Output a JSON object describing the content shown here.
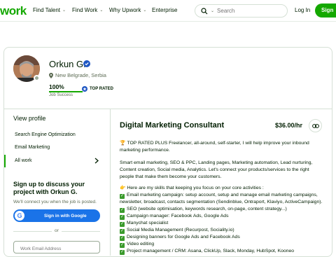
{
  "header": {
    "logo": "work",
    "nav": [
      {
        "label": "Find Talent"
      },
      {
        "label": "Find Work"
      },
      {
        "label": "Why Upwork"
      },
      {
        "label": "Enterprise"
      }
    ],
    "search_placeholder": "Search",
    "login": "Log In",
    "signup": "Sign"
  },
  "profile": {
    "name": "Orkun G.",
    "location": "New Belgrade, Serbia",
    "job_success_pct": "100%",
    "job_success_value": 100,
    "job_success_label": "Job Success",
    "badge": "TOP RATED"
  },
  "sidebar": {
    "view_profile": "View profile",
    "items": [
      {
        "label": "Search Engine Optimization"
      },
      {
        "label": "Email Marketing"
      },
      {
        "label": "All work"
      }
    ],
    "cta_title": "Sign up to discuss your project with Orkun G.",
    "cta_sub": "We'll connect you when the job is posted.",
    "google_btn": "Sign in with Google",
    "or": "or",
    "email_placeholder": "Work Email Address"
  },
  "main": {
    "title": "Digital Marketing Consultant",
    "rate": "$36.00/hr",
    "intro": "TOP RATED PLUS Freelancer, all-around, self-starter, I will help improve your inbound marketing performance.",
    "paragraph": "Smart email marketing, SEO & PPC, Landing pages, Marketing automation, Lead nurturing, Content creation, Social media, Analytics. Let's connect your products/services to the right people that make them become your customers.",
    "skills_intro": "Here are my skills that keeping you focus on your core activities :",
    "skills": [
      "Email marketing campaign: setup account, setup and manage email marketing campaigns, newsletter, broadcast, contacts segmentation (Sendinblue, Ontraport, Klaviyo, ActiveCampaign).",
      "SEO (website optimisation, keywords research, on-page, content strategy...)",
      "Campaign manager: Facebook Ads, Google Ads",
      "Manychat specialist",
      "Social Media Management (Recurpost, Sociality.io)",
      "Designing banners for Google Ads and Facebook Ads",
      "Video editing",
      "Project management / CRM: Asana, ClickUp, Slack, Monday, HubSpot, Kooneo"
    ]
  }
}
